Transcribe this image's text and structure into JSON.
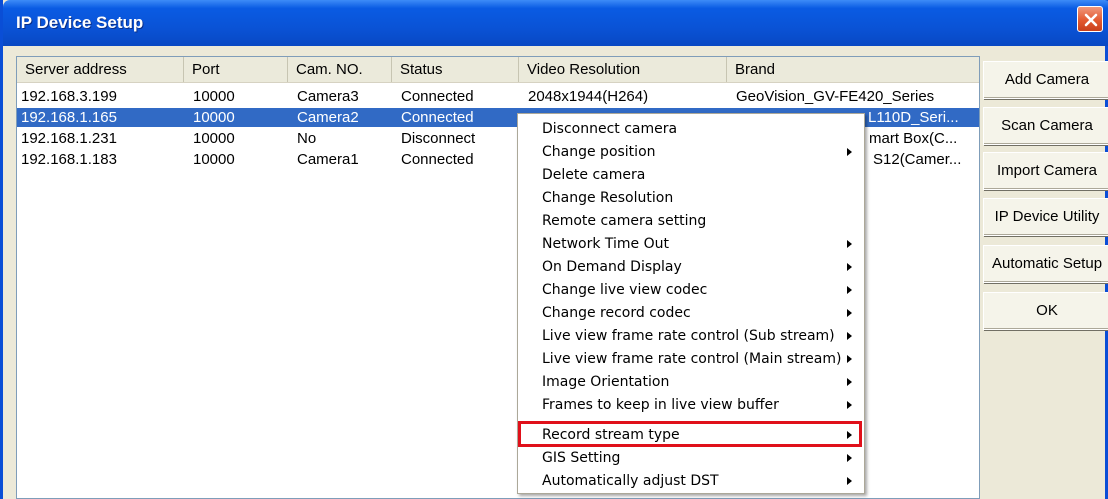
{
  "window": {
    "title": "IP Device Setup"
  },
  "table": {
    "columns": [
      "Server address",
      "Port",
      "Cam. NO.",
      "Status",
      "Video Resolution",
      "Brand"
    ],
    "rows": [
      {
        "server": "192.168.3.199",
        "port": "10000",
        "cam": "Camera3",
        "status": "Connected",
        "resolution": "2048x1944(H264)",
        "brand": "GeoVision_GV-FE420_Series",
        "selected": false
      },
      {
        "server": "192.168.1.165",
        "port": "10000",
        "cam": "Camera2",
        "status": "Connected",
        "resolution": "",
        "brand": "L110D_Seri...",
        "selected": true
      },
      {
        "server": "192.168.1.231",
        "port": "10000",
        "cam": "No",
        "status": "Disconnect",
        "resolution": "",
        "brand": "mart Box(C...",
        "selected": false
      },
      {
        "server": "192.168.1.183",
        "port": "10000",
        "cam": "Camera1",
        "status": "Connected",
        "resolution": "",
        "brand": "S12(Camer...",
        "selected": false
      }
    ]
  },
  "side_buttons": {
    "add": "Add Camera",
    "scan": "Scan Camera",
    "import": "Import Camera",
    "utility": "IP Device Utility",
    "automatic": "Automatic Setup",
    "ok": "OK"
  },
  "context_menu": {
    "items": [
      {
        "label": "Disconnect camera",
        "submenu": false
      },
      {
        "label": "Change position",
        "submenu": true
      },
      {
        "label": "Delete camera",
        "submenu": false
      },
      {
        "label": "Change Resolution",
        "submenu": false
      },
      {
        "label": "Remote camera setting",
        "submenu": false
      },
      {
        "label": "Network Time Out",
        "submenu": true
      },
      {
        "label": "On Demand Display",
        "submenu": true
      },
      {
        "label": "Change live view codec",
        "submenu": true
      },
      {
        "label": "Change record codec",
        "submenu": true
      },
      {
        "label": "Live view frame rate control (Sub stream)",
        "submenu": true
      },
      {
        "label": "Live view frame rate control (Main stream)",
        "submenu": true
      },
      {
        "label": "Image Orientation",
        "submenu": true
      },
      {
        "label": "Frames to keep in live view buffer",
        "submenu": true
      },
      {
        "label": "Record stream type",
        "submenu": true
      },
      {
        "label": "GIS Setting",
        "submenu": true
      },
      {
        "label": "Automatically adjust DST",
        "submenu": true
      }
    ],
    "highlighted": "Record stream type",
    "highlight_color": "#e0101a"
  }
}
